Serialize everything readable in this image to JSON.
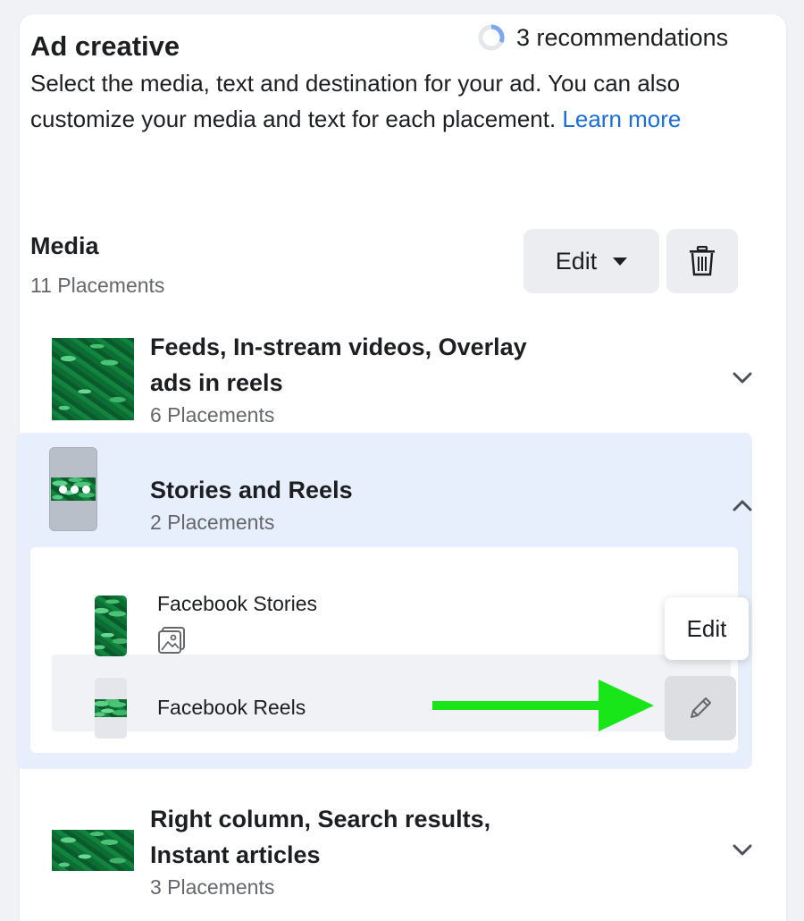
{
  "header": {
    "title": "Ad creative",
    "recommendations_label": "3 recommendations",
    "description": "Select the media, text and destination for your ad. You can also customize your media and text for each placement.",
    "learn_more": "Learn more"
  },
  "media": {
    "title": "Media",
    "count": "11 Placements",
    "edit_label": "Edit",
    "groups": [
      {
        "title_line1": "Feeds, In-stream videos, Overlay",
        "title_line2": "ads in reels",
        "count": "6 Placements"
      },
      {
        "title": "Stories and Reels",
        "count": "2 Placements"
      },
      {
        "title_line1": "Right column, Search results,",
        "title_line2": "Instant articles",
        "count": "3 Placements"
      }
    ],
    "sub_placements": [
      {
        "label": "Facebook Stories"
      },
      {
        "label": "Facebook Reels"
      }
    ],
    "tooltip": "Edit"
  },
  "colors": {
    "accent_link": "#1b6ed2",
    "expanded_bg": "#e7effc",
    "arrow": "#19e619",
    "spinner": "#7aa7f0"
  }
}
